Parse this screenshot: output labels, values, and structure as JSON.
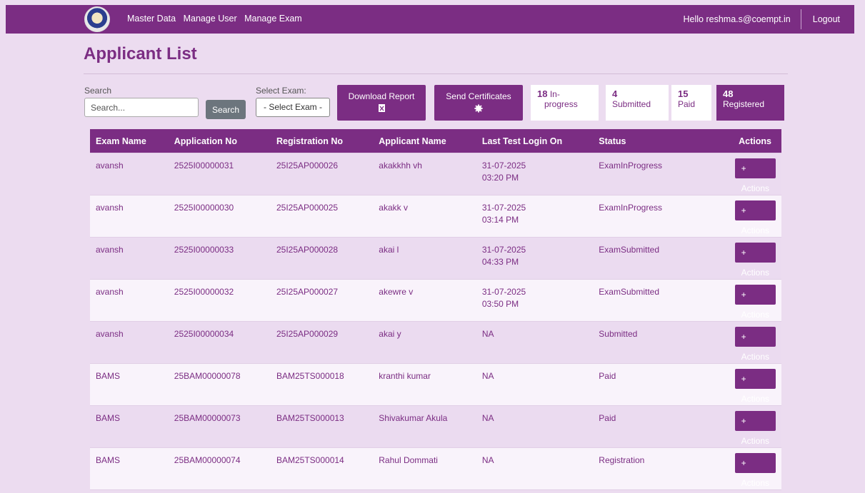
{
  "nav": {
    "links": [
      "Master Data",
      "Manage User",
      "Manage Exam"
    ],
    "greeting": "Hello reshma.s@coempt.in",
    "logout": "Logout"
  },
  "page_title": "Applicant List",
  "filters": {
    "search_label": "Search",
    "search_placeholder": "Search...",
    "search_button": "Search",
    "exam_label": "Select Exam:",
    "exam_selected": "- Select Exam -"
  },
  "actions": {
    "download_report": "Download Report",
    "send_certificates": "Send Certificates"
  },
  "stats": [
    {
      "count": "18",
      "label": "In-progress",
      "label_a": "In-",
      "label_b": "progress"
    },
    {
      "count": "4",
      "label": "Submitted"
    },
    {
      "count": "15",
      "label": "Paid"
    },
    {
      "count": "48",
      "label": "Registered"
    }
  ],
  "table": {
    "headers": [
      "Exam Name",
      "Application No",
      "Registration No",
      "Applicant Name",
      "Last Test Login On",
      "Status",
      "Actions"
    ],
    "action_label": "+ Actions",
    "rows": [
      {
        "exam": "avansh",
        "app": "2525I00000031",
        "reg": "25I25AP000026",
        "name": "akakkhh vh",
        "date": "31-07-2025",
        "time": "03:20 PM",
        "status": "ExamInProgress"
      },
      {
        "exam": "avansh",
        "app": "2525I00000030",
        "reg": "25I25AP000025",
        "name": "akakk v",
        "date": "31-07-2025",
        "time": "03:14 PM",
        "status": "ExamInProgress"
      },
      {
        "exam": "avansh",
        "app": "2525I00000033",
        "reg": "25I25AP000028",
        "name": "akai l",
        "date": "31-07-2025",
        "time": "04:33 PM",
        "status": "ExamSubmitted"
      },
      {
        "exam": "avansh",
        "app": "2525I00000032",
        "reg": "25I25AP000027",
        "name": "akewre v",
        "date": "31-07-2025",
        "time": "03:50 PM",
        "status": "ExamSubmitted"
      },
      {
        "exam": "avansh",
        "app": "2525I00000034",
        "reg": "25I25AP000029",
        "name": "akai y",
        "date": "NA",
        "time": "",
        "status": "Submitted"
      },
      {
        "exam": "BAMS",
        "app": "25BAM00000078",
        "reg": "BAM25TS000018",
        "name": "kranthi kumar",
        "date": "NA",
        "time": "",
        "status": "Paid"
      },
      {
        "exam": "BAMS",
        "app": "25BAM00000073",
        "reg": "BAM25TS000013",
        "name": "Shivakumar Akula",
        "date": "NA",
        "time": "",
        "status": "Paid"
      },
      {
        "exam": "BAMS",
        "app": "25BAM00000074",
        "reg": "BAM25TS000014",
        "name": "Rahul Dommati",
        "date": "NA",
        "time": "",
        "status": "Registration"
      }
    ]
  },
  "colors": {
    "primary": "#7b2d83",
    "background": "#ecdcf0"
  }
}
